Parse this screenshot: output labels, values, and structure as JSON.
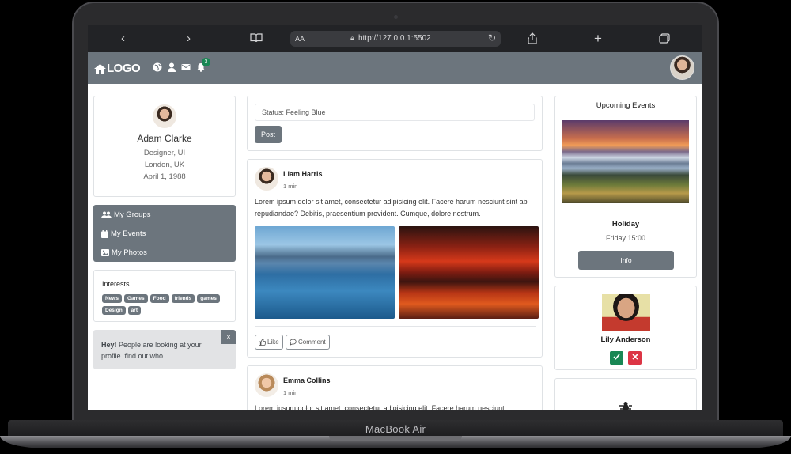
{
  "device": {
    "brand": "MacBook Air"
  },
  "browser": {
    "text_size_label": "AA",
    "url": "http://127.0.0.1:5502",
    "icons": [
      "back-icon",
      "forward-icon",
      "book-icon",
      "lock-icon",
      "reload-icon",
      "share-icon",
      "plus-icon",
      "tabs-icon"
    ]
  },
  "navbar": {
    "logo_text": "LOGO",
    "notification_count": "3",
    "icons": [
      "home-icon",
      "globe-icon",
      "user-icon",
      "envelope-icon",
      "bell-icon"
    ]
  },
  "profile": {
    "name": "Adam Clarke",
    "role": "Designer, UI",
    "location": "London, UK",
    "birthday": "April 1, 1988"
  },
  "menu": {
    "items": [
      {
        "label": "My Groups",
        "icon": "users-icon"
      },
      {
        "label": "My Events",
        "icon": "calendar-icon"
      },
      {
        "label": "My Photos",
        "icon": "image-icon"
      }
    ]
  },
  "interests": {
    "title": "Interests",
    "tags": [
      "News",
      "Games",
      "Food",
      "friends",
      "games",
      "Design",
      "art"
    ]
  },
  "alert": {
    "strong": "Hey!",
    "text": "People are looking at your profile. find out who.",
    "close": "×"
  },
  "status": {
    "input_value": "Status: Feeling Blue",
    "post_label": "Post"
  },
  "posts": [
    {
      "author": "Liam Harris",
      "time": "1 min",
      "text": "Lorem ipsum dolor sit amet, consectetur adipisicing elit. Facere harum nesciunt sint ab repudiandae? Debitis, praesentium provident. Cumque, dolore nostrum.",
      "like_label": "Like",
      "comment_label": "Comment"
    },
    {
      "author": "Emma Collins",
      "time": "1 min",
      "text": "Lorem ipsum dolor sit amet, consectetur adipisicing elit. Facere harum nesciunt"
    }
  ],
  "events": {
    "title": "Upcoming Events",
    "name": "Holiday",
    "time": "Friday 15:00",
    "info_label": "Info"
  },
  "friend_request": {
    "name": "Lily Anderson",
    "accept_icon": "check-icon",
    "decline_icon": "x-icon"
  },
  "colors": {
    "navbar": "#6c757d",
    "success": "#198754",
    "danger": "#dc3545"
  }
}
